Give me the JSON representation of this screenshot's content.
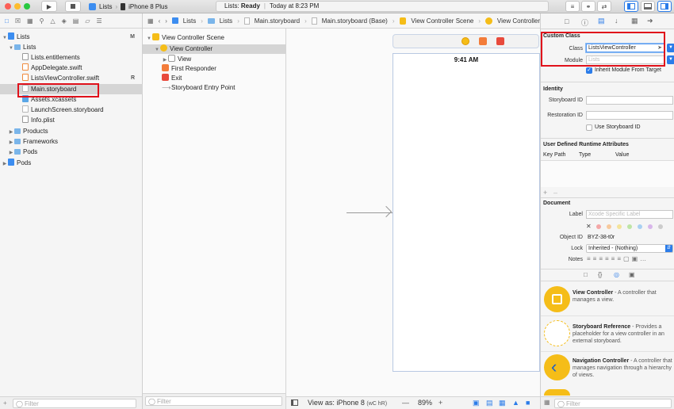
{
  "toolbar": {
    "scheme_target": "Lists",
    "device": "iPhone 8 Plus",
    "status_prefix": "Lists: ",
    "status_state": "Ready",
    "status_time": "Today at 8:23 PM"
  },
  "navigator": {
    "items": [
      {
        "label": "Lists",
        "badge": "M"
      },
      {
        "label": "Lists",
        "badge": ""
      },
      {
        "label": "Lists.entitlements",
        "badge": ""
      },
      {
        "label": "AppDelegate.swift",
        "badge": ""
      },
      {
        "label": "ListsViewController.swift",
        "badge": "R"
      },
      {
        "label": "Main.storyboard",
        "badge": ""
      },
      {
        "label": "Assets.xcassets",
        "badge": ""
      },
      {
        "label": "LaunchScreen.storyboard",
        "badge": ""
      },
      {
        "label": "Info.plist",
        "badge": ""
      },
      {
        "label": "Products",
        "badge": ""
      },
      {
        "label": "Frameworks",
        "badge": ""
      },
      {
        "label": "Pods",
        "badge": ""
      },
      {
        "label": "Pods",
        "badge": ""
      }
    ],
    "filter_placeholder": "Filter"
  },
  "jumpbar": {
    "crumbs": [
      "Lists",
      "Lists",
      "Main.storyboard",
      "Main.storyboard (Base)",
      "View Controller Scene",
      "View Controller"
    ]
  },
  "outline": {
    "scene": "View Controller Scene",
    "vc": "View Controller",
    "view": "View",
    "responder": "First Responder",
    "exit": "Exit",
    "entry": "Storyboard Entry Point",
    "filter_placeholder": "Filter"
  },
  "canvas": {
    "status_time": "9:41 AM",
    "view_as_label": "View as: iPhone 8",
    "view_as_suffix": "(wC hR)",
    "zoom": "89%"
  },
  "inspector": {
    "custom_class": {
      "header": "Custom Class",
      "class_label": "Class",
      "class_value": "ListsViewController",
      "module_label": "Module",
      "module_placeholder": "Lists",
      "inherit_label": "Inherit Module From Target"
    },
    "identity": {
      "header": "Identity",
      "storyboard_id_label": "Storyboard ID",
      "restoration_id_label": "Restoration ID",
      "use_storyboard_label": "Use Storyboard ID"
    },
    "runtime": {
      "header": "User Defined Runtime Attributes",
      "col_keypath": "Key Path",
      "col_type": "Type",
      "col_value": "Value"
    },
    "document": {
      "header": "Document",
      "label_label": "Label",
      "label_placeholder": "Xcode Specific Label",
      "objectid_label": "Object ID",
      "objectid_value": "BYZ-38-t0r",
      "lock_label": "Lock",
      "lock_value": "Inherited - (Nothing)",
      "notes_label": "Notes"
    },
    "library": [
      {
        "title": "View Controller",
        "desc": " - A controller that manages a view."
      },
      {
        "title": "Storyboard Reference",
        "desc": " - Provides a placeholder for a view controller in an external storyboard."
      },
      {
        "title": "Navigation Controller",
        "desc": " - A controller that manages navigation through a hierarchy of views."
      }
    ],
    "filter_placeholder": "Filter"
  },
  "colors": {
    "accent": "#2b7ce9",
    "highlight_box": "#e0111b",
    "selection": "#d5d5d5",
    "library_yellow": "#f5bd18"
  }
}
